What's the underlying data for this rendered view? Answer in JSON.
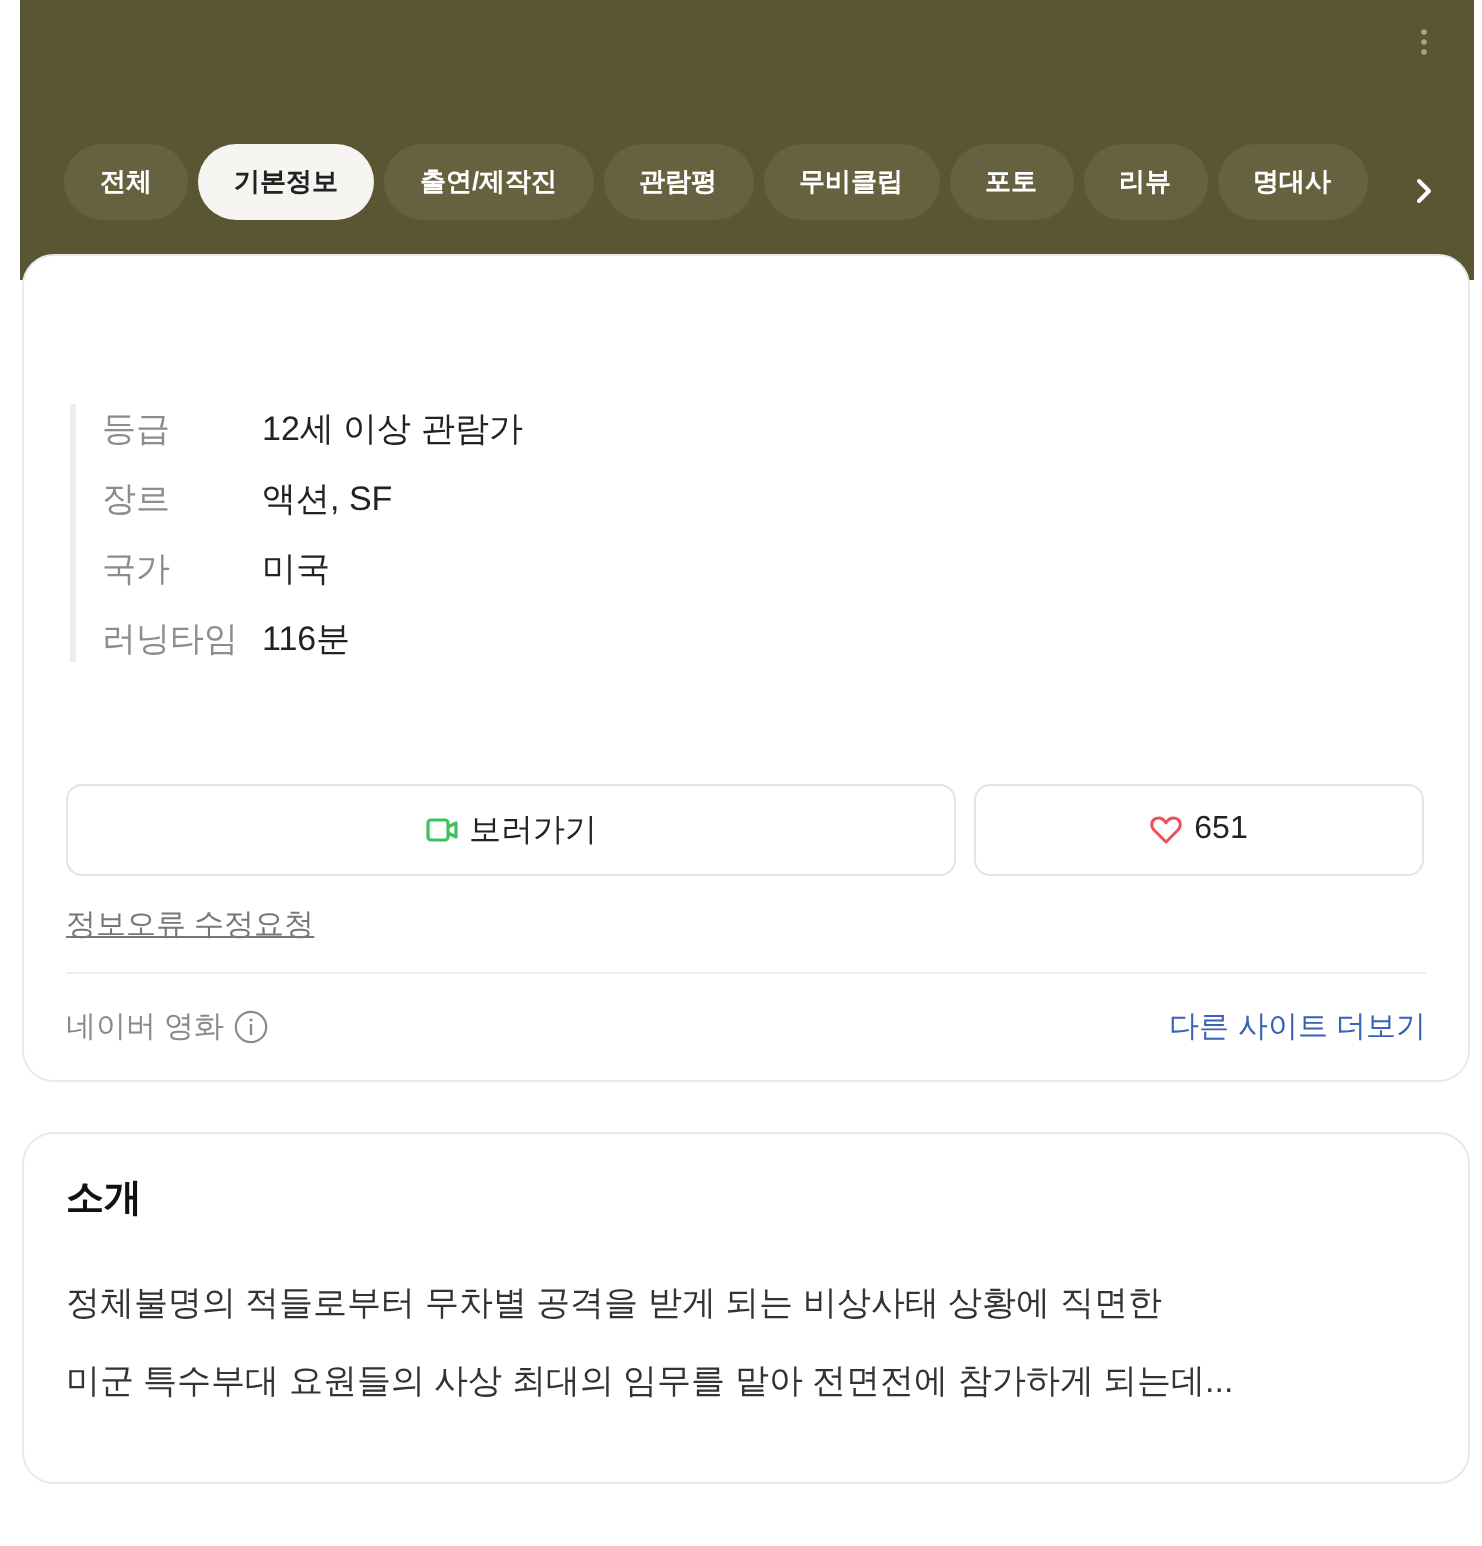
{
  "header": {
    "tabs": [
      {
        "label": "전체",
        "selected": false
      },
      {
        "label": "기본정보",
        "selected": true
      },
      {
        "label": "출연/제작진",
        "selected": false
      },
      {
        "label": "관람평",
        "selected": false
      },
      {
        "label": "무비클립",
        "selected": false
      },
      {
        "label": "포토",
        "selected": false
      },
      {
        "label": "리뷰",
        "selected": false
      },
      {
        "label": "명대사",
        "selected": false
      }
    ]
  },
  "info": {
    "rows": [
      {
        "label": "등급",
        "value": "12세 이상 관람가"
      },
      {
        "label": "장르",
        "value": "액션, SF"
      },
      {
        "label": "국가",
        "value": "미국"
      },
      {
        "label": "러닝타임",
        "value": "116분"
      }
    ],
    "watch_button": {
      "label": "보러가기"
    },
    "like_button": {
      "count": "651"
    },
    "report_link": "정보오류 수정요청",
    "footer": {
      "source": "네이버 영화",
      "more_link": "다른 사이트 더보기"
    }
  },
  "intro": {
    "title": "소개",
    "text": "정체불명의 적들로부터 무차별 공격을 받게 되는 비상사태 상황에 직면한\n미군 특수부대 요원들의 사상 최대의 임무를 맡아 전면전에 참가하게 되는데..."
  }
}
